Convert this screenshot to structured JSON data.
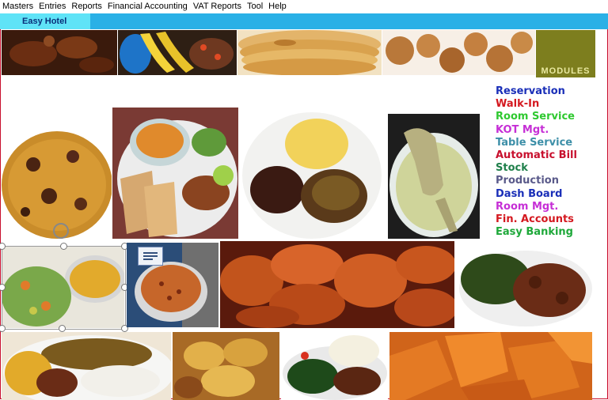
{
  "menu": [
    {
      "label": "Masters"
    },
    {
      "label": "Entries"
    },
    {
      "label": "Reports"
    },
    {
      "label": "Financial Accounting"
    },
    {
      "label": "VAT Reports"
    },
    {
      "label": "Tool"
    },
    {
      "label": "Help"
    }
  ],
  "app": {
    "title": "Easy Hotel"
  },
  "modules_panel": {
    "label": "MODULES"
  },
  "modules": [
    {
      "label": "Reservation",
      "color": "#1a2fb8"
    },
    {
      "label": "Walk-In",
      "color": "#d4181f"
    },
    {
      "label": "Room Service",
      "color": "#2fc930"
    },
    {
      "label": "KOT Mgt.",
      "color": "#c62fd6"
    },
    {
      "label": "Table Service",
      "color": "#3d8fa8"
    },
    {
      "label": "Automatic Bill",
      "color": "#c8102e"
    },
    {
      "label": "Stock",
      "color": "#1e7f4a"
    },
    {
      "label": "Production",
      "color": "#5a5a8a"
    },
    {
      "label": "Dash Board",
      "color": "#1a2fb8"
    },
    {
      "label": "Room Mgt.",
      "color": "#c62fd6"
    },
    {
      "label": "Fin. Accounts",
      "color": "#d4181f"
    },
    {
      "label": "Easy Banking",
      "color": "#1ea83a"
    }
  ],
  "colors": {
    "menu_bg": "#ffffff",
    "title_bar": "#2ab0e6",
    "title_tab": "#5fe3f7",
    "title_text": "#0a2f7a",
    "modules_box": "#7d7e1e",
    "frame_border": "#c8102e"
  }
}
